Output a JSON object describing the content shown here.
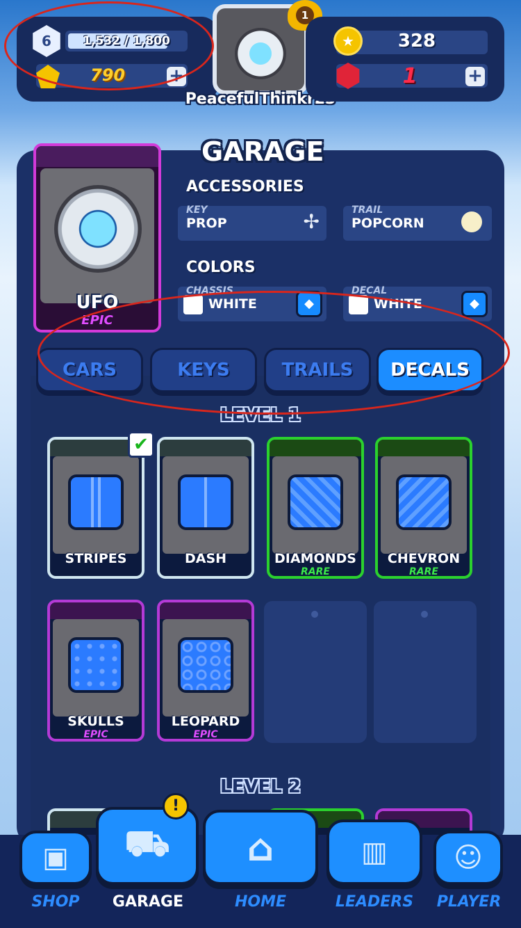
{
  "hud": {
    "player_level": "6",
    "xp_text": "1,532 / 1,800",
    "xp_fraction": 0.851,
    "yellow_gems": "790",
    "avatar_rank": "1",
    "username": "PeacefulThinkr23",
    "coins": "328",
    "rubies": "1",
    "plus_label": "+"
  },
  "garage": {
    "title": "GARAGE",
    "vehicle_name": "UFO",
    "vehicle_rarity": "EPIC",
    "accessories_title": "ACCESSORIES",
    "key_label": "KEY",
    "key_value": "PROP",
    "trail_label": "TRAIL",
    "trail_value": "POPCORN",
    "colors_title": "COLORS",
    "chassis_label": "CHASSIS",
    "chassis_value": "WHITE",
    "decal_label": "DECAL",
    "decal_value": "WHITE"
  },
  "tabs": [
    {
      "label": "CARS",
      "active": false
    },
    {
      "label": "KEYS",
      "active": false
    },
    {
      "label": "TRAILS",
      "active": false
    },
    {
      "label": "DECALS",
      "active": true
    }
  ],
  "levels": {
    "level1": "LEVEL 1",
    "level2": "LEVEL 2"
  },
  "decals_level1": [
    {
      "name": "STRIPES",
      "rarity": "",
      "equipped": true
    },
    {
      "name": "DASH",
      "rarity": ""
    },
    {
      "name": "DIAMONDS",
      "rarity": "RARE"
    },
    {
      "name": "CHEVRON",
      "rarity": "RARE"
    },
    {
      "name": "SKULLS",
      "rarity": "EPIC"
    },
    {
      "name": "LEOPARD",
      "rarity": "EPIC"
    }
  ],
  "nav": {
    "alert": "!",
    "shop": "SHOP",
    "garage": "GARAGE",
    "home": "HOME",
    "leaders": "LEADERS",
    "player": "PLAYER"
  },
  "colors": {
    "accent": "#1e8fff",
    "panel": "#1b3067",
    "epic": "#d23ad9",
    "rare": "#2bd12e",
    "annotation": "#d9261c"
  }
}
